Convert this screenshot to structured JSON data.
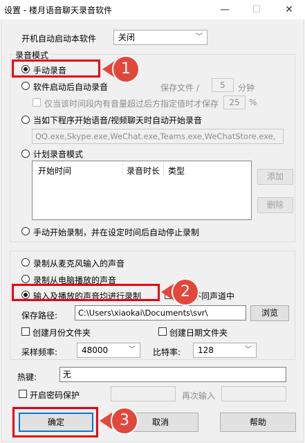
{
  "window": {
    "title": "设置 - 楼月语音聊天录音软件",
    "minimize_glyph": "—",
    "maximize_glyph": "☐",
    "close_glyph": "✕"
  },
  "autostart": {
    "label": "开机自动启动本软件",
    "value": "关闭"
  },
  "record_mode": {
    "group_title": "录音模式",
    "manual": "手动录音",
    "auto_on_launch": "软件启动后自动录音",
    "save_file_label": "保存文件 /",
    "save_file_minutes": "5",
    "minutes_unit": "分钟",
    "volume_only": "仅当该时间段内有音量超过后方指定值时才保存",
    "volume_threshold": "25",
    "percent_unit": "%",
    "on_program_open": "当如下程序开始语音/视频聊天时自动开始录音",
    "program_list": "QQ.exe,Skype.exe,WeChat.exe,Teams.exe,WeChatStore.exe,",
    "scheduled": "计划录音模式",
    "schedule_columns": [
      "开始时间",
      "录音时长",
      "类型"
    ],
    "add_button": "添加",
    "delete_button": "删除",
    "manual_start_auto_stop": "手动开始录制，并在设定时间后自动停止录制"
  },
  "source": {
    "mic": "录制从麦克风输入的声音",
    "speaker": "录制从电脑播放的声音",
    "both": "输入及播放的声音均进行录制",
    "separate_channels": "存在不同声道中",
    "save_path_label": "保存路径:",
    "save_path_value": "C:\\Users\\xiaokai\\Documents\\svr\\",
    "browse_button": "浏览",
    "monthly_folder": "创建月份文件夹",
    "date_folder": "创建日期文件夹",
    "sample_rate_label": "采样频率:",
    "sample_rate_value": "48000",
    "bitrate_label": "比特率:",
    "bitrate_value": "128"
  },
  "hotkey": {
    "label": "热键:",
    "value": "无"
  },
  "password": {
    "enable_label": "开启密码保护",
    "repeat_label": "再次输入"
  },
  "buttons": {
    "ok": "确定",
    "cancel": "取消",
    "help": "帮助"
  },
  "annotations": {
    "badge1": "1",
    "badge2": "2",
    "badge3": "3"
  },
  "colors": {
    "annotation_red": "#e60012",
    "badge_fill": "#e2473c",
    "focus_blue": "#0078d7"
  }
}
